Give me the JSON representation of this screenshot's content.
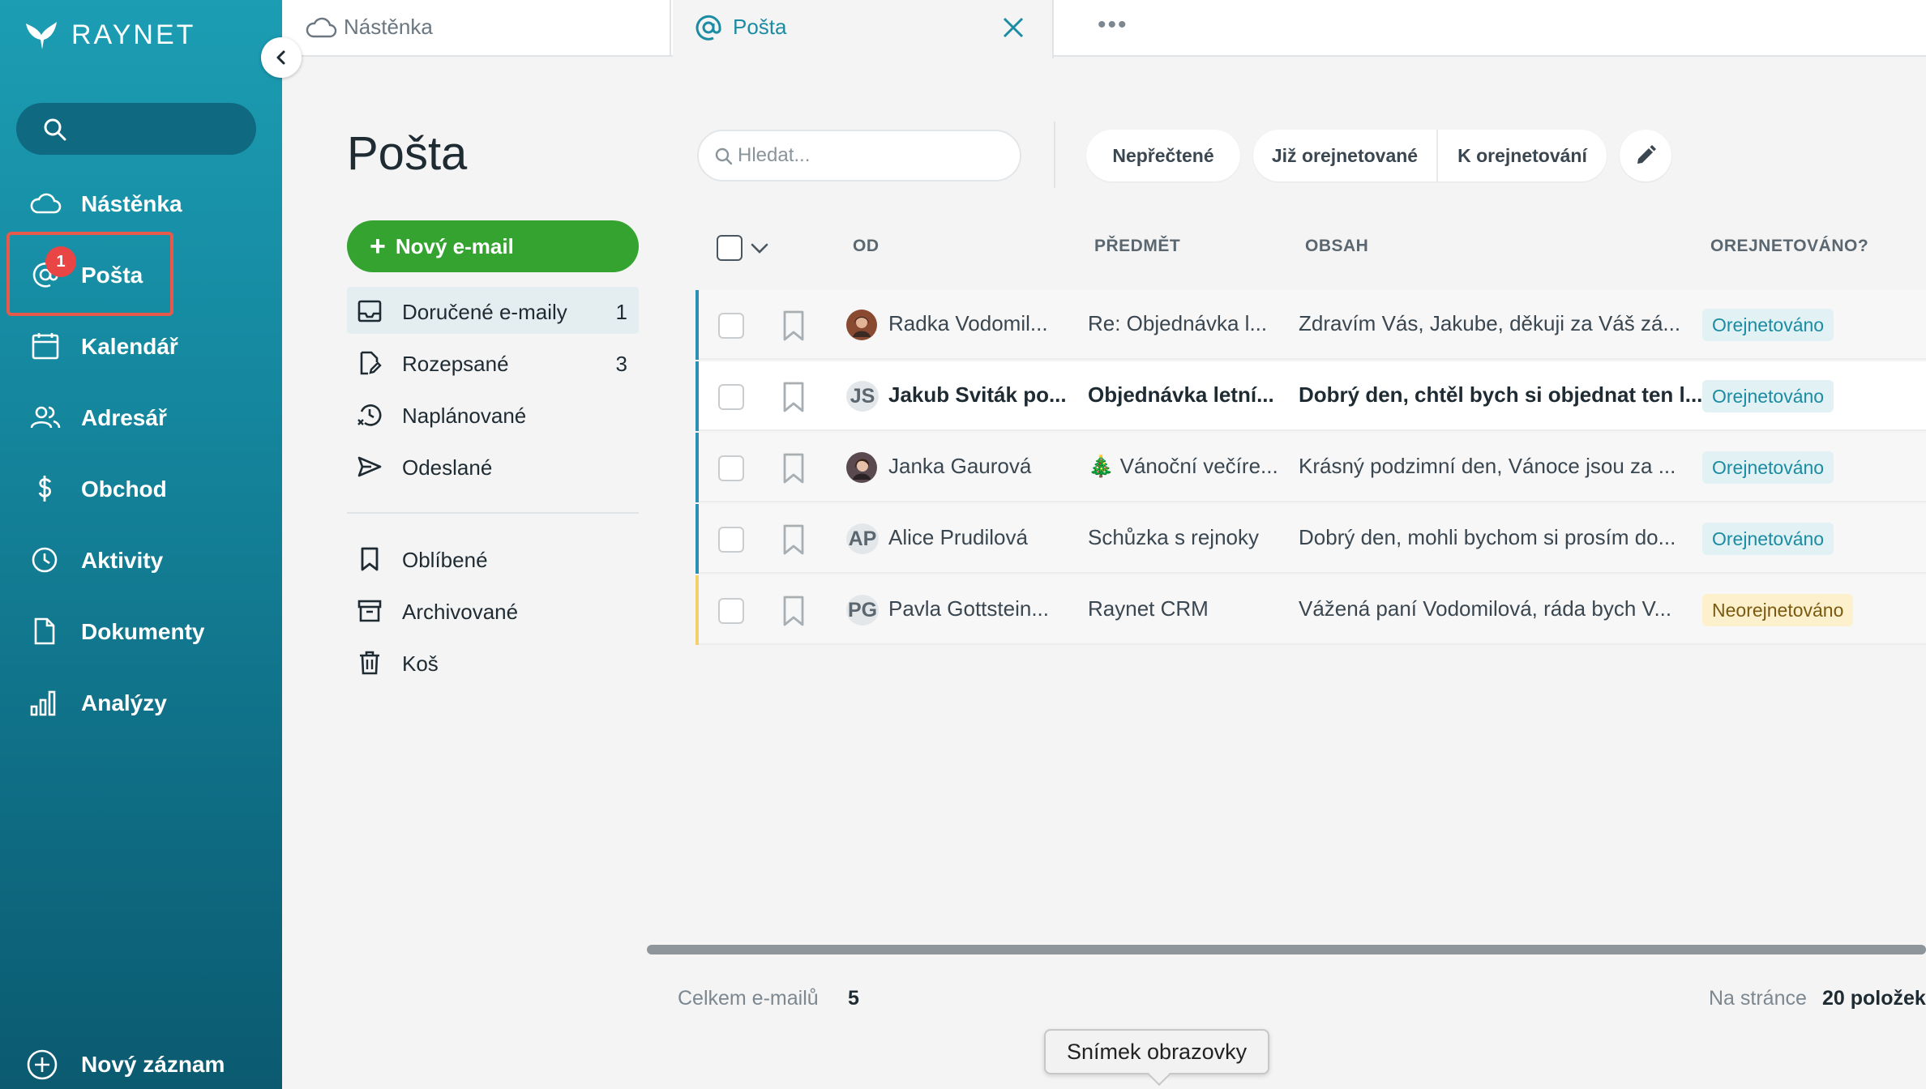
{
  "app": {
    "logo_text": "RAYNET",
    "colors": {
      "brand": "#1c9db3",
      "accent_green": "#34a32f",
      "badge_red": "#e94545",
      "link": "#1b8ca3"
    }
  },
  "sidebar": {
    "search_icon": "search-icon",
    "items": [
      {
        "label": "Nástěnka",
        "icon": "cloud-icon"
      },
      {
        "label": "Pošta",
        "icon": "at-icon",
        "badge": "1"
      },
      {
        "label": "Kalendář",
        "icon": "calendar-icon"
      },
      {
        "label": "Adresář",
        "icon": "contacts-icon"
      },
      {
        "label": "Obchod",
        "icon": "dollar-icon"
      },
      {
        "label": "Aktivity",
        "icon": "clock-icon"
      },
      {
        "label": "Dokumenty",
        "icon": "document-icon"
      },
      {
        "label": "Analýzy",
        "icon": "bar-chart-icon"
      }
    ],
    "new_record_label": "Nový záznam"
  },
  "tabs": [
    {
      "label": "Nástěnka",
      "icon": "cloud-icon"
    },
    {
      "label": "Pošta",
      "icon": "at-icon"
    }
  ],
  "main": {
    "title": "Pošta",
    "search": {
      "placeholder": "Hledat..."
    },
    "filters": {
      "unread": "Nepřečtené",
      "tagged": "Již orejnetované",
      "to_tag": "K orejnetování"
    },
    "new_email_label": "Nový e-mail",
    "folders": [
      {
        "label": "Doručené e-maily",
        "count": "1",
        "icon": "inbox-icon"
      },
      {
        "label": "Rozepsané",
        "count": "3",
        "icon": "draft-icon"
      },
      {
        "label": "Naplánované",
        "count": "",
        "icon": "scheduled-icon"
      },
      {
        "label": "Odeslané",
        "count": "",
        "icon": "send-icon"
      }
    ],
    "folders2": [
      {
        "label": "Oblíbené",
        "icon": "bookmark-icon"
      },
      {
        "label": "Archivované",
        "icon": "archive-icon"
      },
      {
        "label": "Koš",
        "icon": "trash-icon"
      }
    ],
    "table": {
      "headers": {
        "from": "OD",
        "subject": "PŘEDMĚT",
        "content": "OBSAH",
        "tagged": "OREJNETOVÁNO?"
      },
      "rows": [
        {
          "initials": "",
          "from": "Radka Vodomil...",
          "subject": "Re: Objednávka l...",
          "content": "Zdravím Vás, Jakube, děkuji za Váš zá...",
          "status": "Orejnetováno",
          "unread": false
        },
        {
          "initials": "JS",
          "from": "Jakub Sviták po...",
          "subject": "Objednávka letní...",
          "content": "Dobrý den, chtěl bych si objednat ten l...",
          "status": "Orejnetováno",
          "unread": true
        },
        {
          "initials": "",
          "from": "Janka Gaurová",
          "subject": "🎄 Vánoční večíre...",
          "content": "Krásný podzimní den, Vánoce jsou za ...",
          "status": "Orejnetováno",
          "unread": false
        },
        {
          "initials": "AP",
          "from": "Alice Prudilová",
          "subject": "Schůzka s rejnoky",
          "content": "Dobrý den, mohli bychom si prosím do...",
          "status": "Orejnetováno",
          "unread": false
        },
        {
          "initials": "PG",
          "from": "Pavla Gottstein...",
          "subject": "Raynet CRM",
          "content": "Vážená paní Vodomilová, ráda bych V...",
          "status": "Neorejnetováno",
          "unread": false
        }
      ]
    },
    "footer": {
      "total_label": "Celkem e-mailů",
      "total_value": "5",
      "per_page_label": "Na stránce",
      "per_page_value": "20 položek"
    }
  },
  "tooltip": {
    "text": "Snímek obrazovky"
  }
}
